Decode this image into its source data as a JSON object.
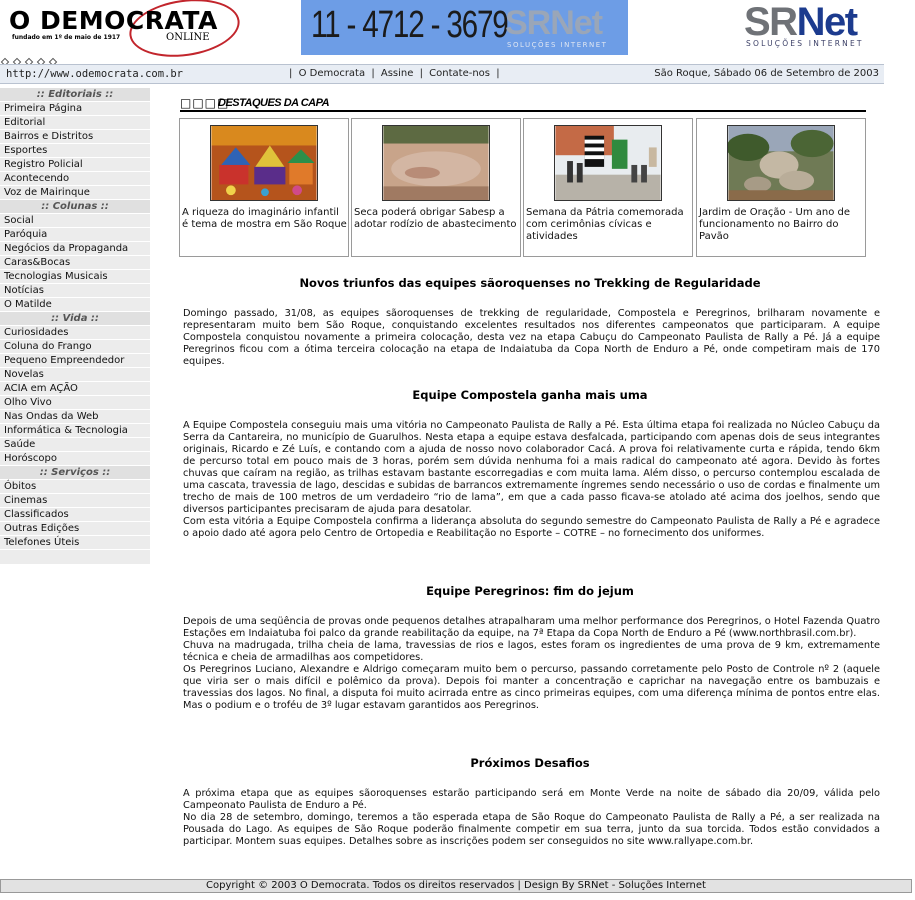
{
  "header": {
    "logo_title": "O DEMOCRATA",
    "logo_tagline": "fundado em 1º de maio de 1917",
    "logo_online": "ONLINE",
    "banner_phone": "11 - 4712 - 3679",
    "banner_brand": "SRNet",
    "banner_brand_sub": "SOLUÇÕES INTERNET",
    "brand_sr": "SR",
    "brand_net": "Net",
    "brand_sub": "SOLUÇÕES INTERNET"
  },
  "topbar": {
    "url": "http://www.odemocrata.com.br",
    "nav_separator": "|",
    "nav": [
      "O Democrata",
      "Assine",
      "Contate-nos"
    ],
    "date": "São Roque, Sábado 06 de Setembro de 2003"
  },
  "sidebar": {
    "sections": [
      {
        "title": ":: Editoriais ::",
        "items": [
          "Primeira Página",
          "Editorial",
          "Bairros e Distritos",
          "Esportes",
          "Registro Policial",
          "Acontecendo",
          "Voz de Mairinque"
        ]
      },
      {
        "title": ":: Colunas ::",
        "items": [
          "Social",
          "Paróquia",
          "Negócios da Propaganda",
          "Caras&Bocas",
          "Tecnologias Musicais",
          "Notícias",
          "O Matilde"
        ]
      },
      {
        "title": ":: Vida ::",
        "items": [
          "Curiosidades",
          "Coluna do Frango",
          "Pequeno Empreendedor",
          "Novelas",
          "ACIA em AÇÃO",
          "Olho Vivo",
          "Nas Ondas da Web",
          "Informática & Tecnologia",
          "Saúde",
          "Horóscopo"
        ]
      },
      {
        "title": ":: Serviços ::",
        "items": [
          "Óbitos",
          "Cinemas",
          "Classificados",
          "Outras Edições",
          "Telefones Úteis"
        ]
      }
    ]
  },
  "destaques": {
    "squares": "□□□□",
    "title": "DESTAQUES DA CAPA",
    "cards": [
      {
        "caption": "A riqueza do imaginário infantil é tema de mostra em São Roque",
        "image": "colorful-painting-thumbnail"
      },
      {
        "caption": "Seca poderá obrigar Sabesp a adotar rodízio de abastecimento",
        "image": "dry-reservoir-thumbnail"
      },
      {
        "caption": "Semana da Pátria comemorada com cerimônias cívicas e atividades",
        "image": "flag-ceremony-thumbnail"
      },
      {
        "caption": "Jardim de Oração - Um ano de funcionamento no Bairro do Pavão",
        "image": "prayer-garden-thumbnail"
      }
    ]
  },
  "articles": [
    {
      "title": "Novos triunfos das equipes sãoroquenses no Trekking de Regularidade",
      "paragraphs": [
        "Domingo passado, 31/08, as equipes sãoroquenses de trekking de regularidade, Compostela e Peregrinos, brilharam novamente e representaram muito bem São Roque, conquistando excelentes resultados nos diferentes campeonatos que participaram. A equipe Compostela conquistou novamente a primeira colocação, desta vez na etapa Cabuçu do Campeonato Paulista de Rally a Pé. Já a equipe Peregrinos ficou com a ótima terceira colocação na etapa de Indaiatuba da Copa North de Enduro a Pé, onde competiram mais de 170 equipes."
      ]
    },
    {
      "title": "Equipe Compostela ganha mais uma",
      "paragraphs": [
        "A Equipe Compostela conseguiu mais uma vitória no Campeonato Paulista de Rally a Pé. Esta última etapa foi realizada no Núcleo Cabuçu da Serra da Cantareira, no município de Guarulhos. Nesta etapa a equipe estava desfalcada, participando com apenas dois de seus integrantes originais, Ricardo e Zé Luís, e contando com a ajuda de nosso novo colaborador Cacá. A prova foi relativamente curta e rápida, tendo 6km de percurso total em pouco mais de 3 horas, porém sem dúvida nenhuma foi a mais radical do campeonato até agora. Devido às fortes chuvas que caíram na região, as trilhas estavam bastante escorregadias e com muita lama. Além disso, o percurso contemplou escalada de uma cascata, travessia de lago, descidas e subidas de barrancos extremamente íngremes sendo necessário o uso de cordas e finalmente um trecho de mais de 100 metros de um verdadeiro “rio de lama”, em que a cada passo ficava-se atolado até acima dos joelhos, sendo que diversos participantes precisaram de ajuda para desatolar.",
        "Com esta vitória a Equipe Compostela confirma a liderança absoluta do segundo semestre do Campeonato Paulista de Rally a Pé e agradece o apoio dado até agora pelo Centro de Ortopedia e Reabilitação no Esporte – COTRE – no fornecimento dos uniformes."
      ]
    },
    {
      "title": "Equipe Peregrinos: fim do jejum",
      "paragraphs": [
        "Depois de uma seqüência de provas onde pequenos detalhes atrapalharam uma melhor performance dos Peregrinos, o Hotel Fazenda Quatro Estações em Indaiatuba foi palco da grande reabilitação da equipe, na 7ª Etapa da Copa North de Enduro a Pé (www.northbrasil.com.br).",
        "Chuva na madrugada, trilha cheia de lama, travessias de rios e lagos, estes foram os ingredientes de uma prova de 9 km, extremamente técnica e cheia de armadilhas aos competidores.",
        "Os Peregrinos Luciano, Alexandre e Aldrigo começaram muito bem o percurso, passando corretamente pelo Posto de Controle nº 2 (aquele que viria ser o mais difícil e polêmico da prova). Depois foi manter a concentração e caprichar na navegação entre os bambuzais e travessias dos lagos. No final, a disputa foi muito acirrada entre as cinco primeiras equipes, com uma diferença mínima de pontos entre elas. Mas o podium e o troféu de 3º lugar estavam garantidos aos Peregrinos."
      ]
    },
    {
      "title": "Próximos Desafios",
      "paragraphs": [
        "A próxima etapa que as equipes sãoroquenses estarão participando será em Monte Verde na noite de sábado dia 20/09, válida pelo Campeonato Paulista de Enduro a Pé.",
        "No dia 28 de setembro, domingo, teremos a tão esperada etapa de São Roque do Campeonato Paulista de Rally a Pé, a ser realizada na Pousada do Lago. As equipes de São Roque poderão finalmente competir em sua terra, junto da sua torcida. Todos estão convidados a participar. Montem suas equipes. Detalhes sobre as inscrições podem ser conseguidos no site www.rallyape.com.br."
      ]
    }
  ],
  "footer": {
    "text": "Copyright © 2003 O Democrata. Todos os direitos reservados | Design By SRNet - Soluções Internet"
  },
  "colors": {
    "banner_bg": "#6d9de6",
    "logo_oval": "#c2252c",
    "brand_blue": "#1c3b8e",
    "nav_bar_bg": "#e8edf4",
    "sidebar_bg": "#ececec"
  }
}
